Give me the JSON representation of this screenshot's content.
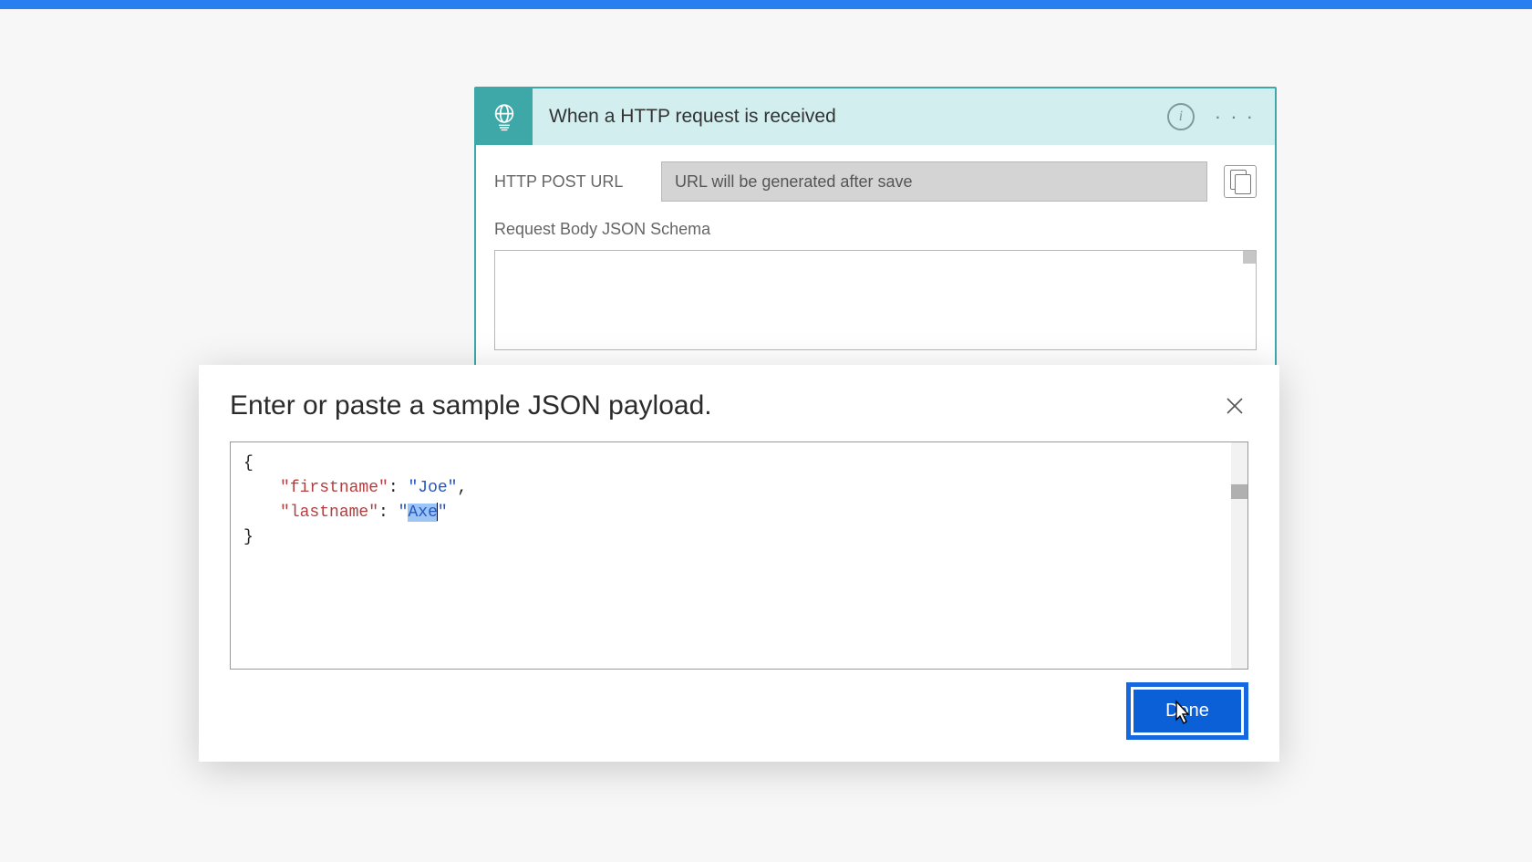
{
  "trigger": {
    "title": "When a HTTP request is received",
    "postUrlLabel": "HTTP POST URL",
    "postUrlPlaceholder": "URL will be generated after save",
    "schemaLabel": "Request Body JSON Schema"
  },
  "modal": {
    "title": "Enter or paste a sample JSON payload.",
    "doneLabel": "Done",
    "json": {
      "key1": "firstname",
      "val1": "Joe",
      "key2": "lastname",
      "val2": "Axe"
    }
  }
}
